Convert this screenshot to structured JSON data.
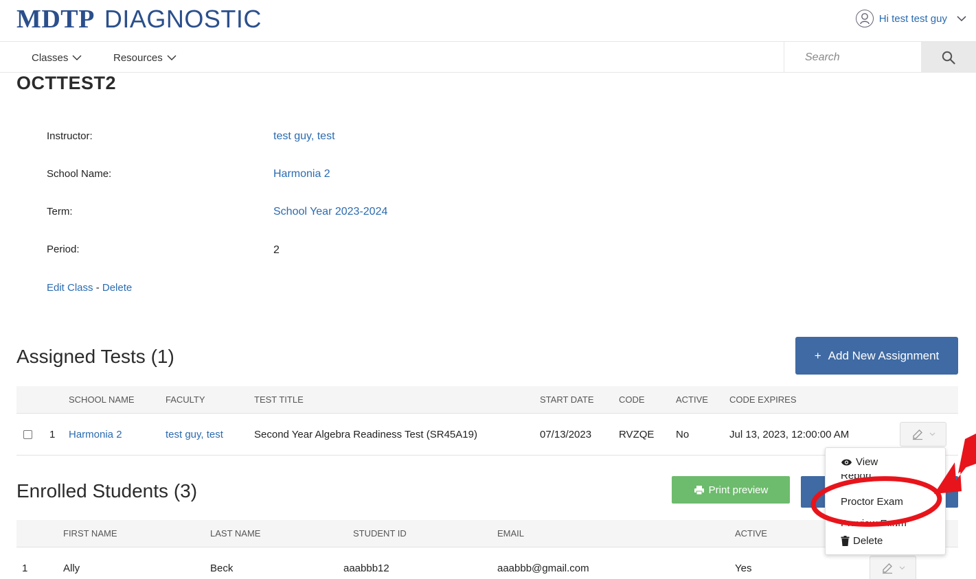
{
  "header": {
    "brand_main": "MDTP",
    "brand_sub": "DIAGNOSTIC",
    "user_greeting": "Hi test test guy"
  },
  "nav": {
    "classes_label": "Classes",
    "resources_label": "Resources",
    "search_placeholder": "Search"
  },
  "class_info": {
    "title": "OCTTEST2",
    "fields": [
      {
        "label": "Instructor:",
        "value": "test guy, test"
      },
      {
        "label": "School Name:",
        "value": "Harmonia 2"
      },
      {
        "label": "Term:",
        "value": "School Year 2023-2024"
      },
      {
        "label": "Period:",
        "value": "2"
      }
    ],
    "edit_label": "Edit Class",
    "separator": "-",
    "delete_label": "Delete"
  },
  "assigned_tests": {
    "title": "Assigned Tests (1)",
    "add_button_label": "Add New Assignment",
    "columns": [
      "SCHOOL NAME",
      "FACULTY",
      "TEST TITLE",
      "START DATE",
      "CODE",
      "ACTIVE",
      "CODE EXPIRES"
    ],
    "rows": [
      {
        "index": "1",
        "school_name": "Harmonia 2",
        "faculty": "test guy, test",
        "test_title": "Second Year Algebra Readiness Test (SR45A19)",
        "start_date": "07/13/2023",
        "code": "RVZQE",
        "active": "No",
        "code_expires": "Jul 13, 2023, 12:00:00 AM"
      }
    ]
  },
  "dropdown_menu": {
    "items": [
      {
        "label": "View",
        "icon": "eye-icon"
      },
      {
        "label": "Report",
        "icon": ""
      },
      {
        "label": "Proctor Exam",
        "icon": ""
      },
      {
        "label": "Preview Exam",
        "icon": ""
      },
      {
        "label": "Delete",
        "icon": "trash-icon"
      }
    ]
  },
  "enrolled_students": {
    "title": "Enrolled Students (3)",
    "print_label": "Print preview",
    "columns": [
      "FIRST NAME",
      "LAST NAME",
      "STUDENT ID",
      "EMAIL",
      "ACTIVE"
    ],
    "rows": [
      {
        "index": "1",
        "first_name": "Ally",
        "last_name": "Beck",
        "student_id": "aaabbb12",
        "email": "aaabbb@gmail.com",
        "active": "Yes"
      }
    ]
  },
  "colors": {
    "brand": "#2b4f8c",
    "link": "#2a6bb0",
    "primary_button": "#3f6aa3",
    "success_button": "#6dbb6d",
    "annotation_red": "#e8141b"
  }
}
